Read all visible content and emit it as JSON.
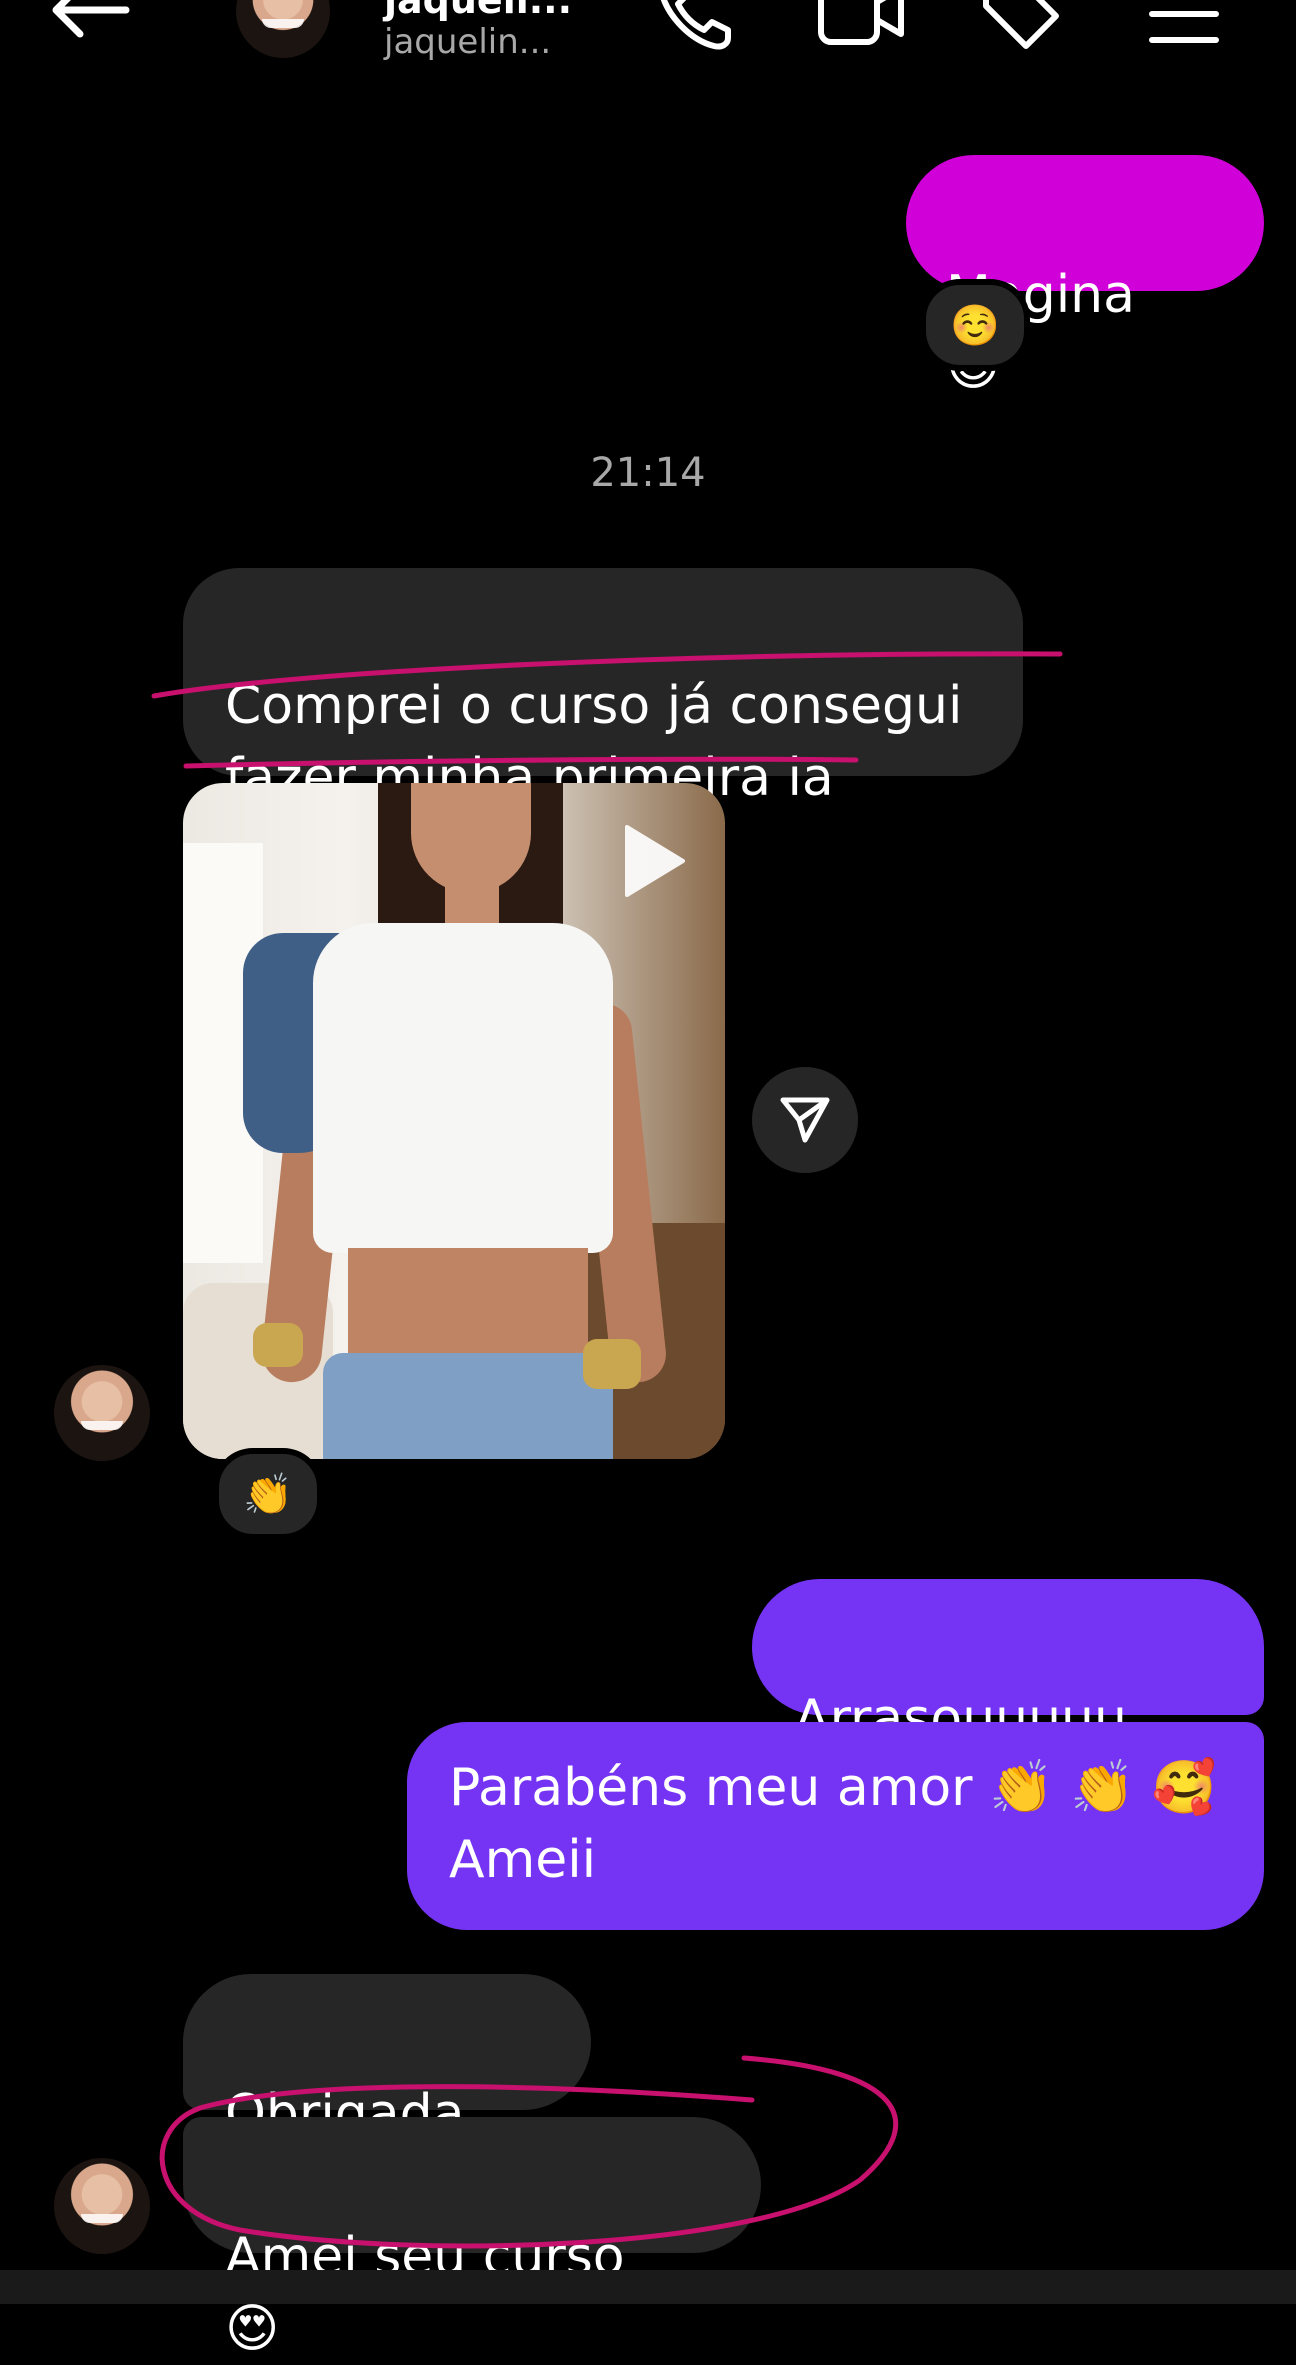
{
  "header": {
    "contact_name": "jaqueli...",
    "contact_username": "jaquelin..."
  },
  "icons": {
    "back": "arrow-left-icon",
    "call": "phone-icon",
    "video": "video-camera-icon",
    "tag": "tag-icon",
    "menu": "menu-icon",
    "share": "send-icon",
    "play": "play-icon"
  },
  "messages": [
    {
      "direction": "out",
      "text": "Magina",
      "emoji": "😊",
      "reaction": "☺️"
    },
    {
      "timestamp": "21:14"
    },
    {
      "direction": "in",
      "text": "Comprei o curso já consegui fazer minha primeira ia"
    },
    {
      "direction": "in",
      "type": "video",
      "reaction": "👏"
    },
    {
      "direction": "out",
      "text": "Arrasouuuuu",
      "emoji": "🤩"
    },
    {
      "direction": "out",
      "line1": "Parabéns meu amor",
      "emoji": "👏 👏 🥰",
      "line2": "Ameii"
    },
    {
      "direction": "in",
      "text": "Obrigada",
      "emoji": "😃"
    },
    {
      "direction": "in",
      "text": "Amei seu curso",
      "emoji": "😍"
    }
  ],
  "colors": {
    "background": "#000000",
    "incoming_bubble": "#262626",
    "outgoing_pink": "#d000d8",
    "outgoing_purple": "#7534f4",
    "annotation": "#c8106e"
  }
}
